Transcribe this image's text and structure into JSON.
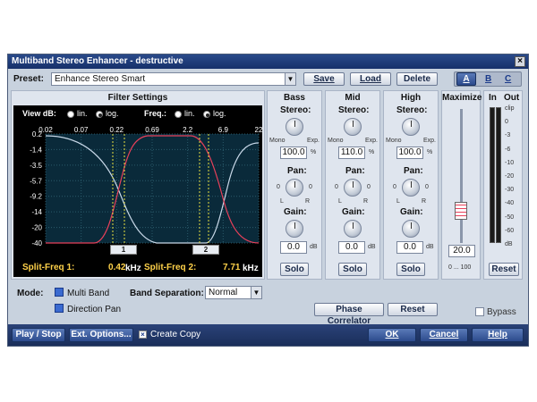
{
  "window": {
    "title": "Multiband Stereo Enhancer - destructive",
    "close_label": "×"
  },
  "preset": {
    "label": "Preset:",
    "value": "Enhance Stereo Smart",
    "save": "Save",
    "load": "Load",
    "delete": "Delete",
    "abc": [
      "A",
      "B",
      "C"
    ]
  },
  "filter": {
    "title": "Filter Settings",
    "view_db_label": "View dB:",
    "lin": "lin.",
    "log": "log.",
    "freq_label": "Freq.:",
    "freq_ticks": [
      "0.02",
      "0.07",
      "0.22",
      "0.69",
      "2.2",
      "6.9",
      "22"
    ],
    "db_ticks": [
      "0.2",
      "-1.4",
      "-3.5",
      "-5.7",
      "-9.2",
      "-14",
      "-20",
      "-40"
    ],
    "handle1": "1",
    "handle2": "2",
    "split1_label": "Split-Freq 1:",
    "split1_value": "0.42",
    "split1_unit": "kHz",
    "split2_label": "Split-Freq 2:",
    "split2_value": "7.71",
    "split2_unit": "kHz"
  },
  "bands": [
    {
      "name": "Bass",
      "stereo_label": "Stereo:",
      "mono": "Mono",
      "exp": "Exp.",
      "stereo_value": "100.0",
      "pct": "%",
      "pan_label": "Pan:",
      "pan_l_num": "0",
      "pan_r_num": "0",
      "L": "L",
      "R": "R",
      "gain_label": "Gain:",
      "gain_value": "0.0",
      "db": "dB",
      "solo": "Solo"
    },
    {
      "name": "Mid",
      "stereo_label": "Stereo:",
      "mono": "Mono",
      "exp": "Exp.",
      "stereo_value": "110.0",
      "pct": "%",
      "pan_label": "Pan:",
      "pan_l_num": "0",
      "pan_r_num": "0",
      "L": "L",
      "R": "R",
      "gain_label": "Gain:",
      "gain_value": "0.0",
      "db": "dB",
      "solo": "Solo"
    },
    {
      "name": "High",
      "stereo_label": "Stereo:",
      "mono": "Mono",
      "exp": "Exp.",
      "stereo_value": "100.0",
      "pct": "%",
      "pan_label": "Pan:",
      "pan_l_num": "0",
      "pan_r_num": "0",
      "L": "L",
      "R": "R",
      "gain_label": "Gain:",
      "gain_value": "0.0",
      "db": "dB",
      "solo": "Solo"
    }
  ],
  "maximize": {
    "title": "Maximize",
    "value": "20.0",
    "range": "0 ... 100",
    "level": 0.2
  },
  "meters": {
    "in": "In",
    "out": "Out",
    "ticks": [
      "clip",
      "0",
      "-3",
      "-6",
      "-10",
      "-20",
      "-30",
      "-40",
      "-50",
      "-60",
      "dB"
    ],
    "reset": "Reset"
  },
  "mode": {
    "label": "Mode:",
    "multi_band": "Multi Band",
    "direction_pan": "Direction Pan",
    "band_sep_label": "Band Separation:",
    "band_sep_value": "Normal"
  },
  "phase_correlator": "Phase Correlator",
  "reset": "Reset",
  "bypass": "Bypass",
  "bottom": {
    "play_stop": "Play / Stop",
    "ext_options": "Ext. Options...",
    "create_copy": "Create Copy",
    "ok": "OK",
    "cancel": "Cancel",
    "help": "Help"
  },
  "colors": {
    "accent": "#2c4a8c",
    "crossover_low": "#e8405a",
    "crossover_high": "#c8d8e8",
    "marker": "#e8e040"
  }
}
